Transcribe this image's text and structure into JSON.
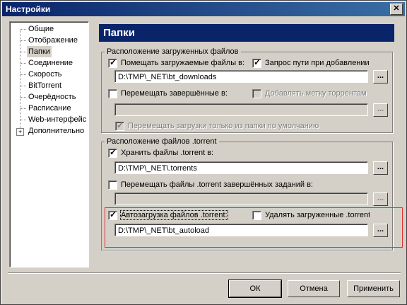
{
  "window": {
    "title": "Настройки"
  },
  "tree": {
    "items": [
      {
        "label": "Общие"
      },
      {
        "label": "Отображение"
      },
      {
        "label": "Папки"
      },
      {
        "label": "Соединение"
      },
      {
        "label": "Скорость"
      },
      {
        "label": "BitTorrent"
      },
      {
        "label": "Очерёдность"
      },
      {
        "label": "Расписание"
      },
      {
        "label": "Web-интерфейс"
      },
      {
        "label": "Дополнительно",
        "expander": "+"
      }
    ]
  },
  "panel": {
    "title": "Папки"
  },
  "downloads_group": {
    "legend": "Расположение загруженных файлов",
    "put_downloads_label": "Помещать загружаемые файлы в:",
    "ask_path_label": "Запрос пути при добавлении",
    "downloads_path": "D:\\TMP\\_NET\\bt_downloads",
    "move_completed_label": "Перемещать завершённые в:",
    "append_label_label": "Добавлять метку торрентам",
    "completed_path": "",
    "only_default_label": "Перемещать загрузки только из папки по умолчанию"
  },
  "torrent_group": {
    "legend": "Расположение файлов .torrent",
    "store_torrents_label": "Хранить файлы .torrent в:",
    "torrents_path": "D:\\TMP\\_NET\\.torrents",
    "move_completed_torrents_label": "Перемещать файлы .torrent завершённых заданий в:",
    "completed_torrents_path": "",
    "autoload_label": "Автозагрузка файлов .torrent:",
    "delete_loaded_label": "Удалять загруженные .torrent",
    "autoload_path": "D:\\TMP\\_NET\\bt_autoload"
  },
  "browse_label": "...",
  "buttons": {
    "ok": "ОК",
    "cancel": "Отмена",
    "apply": "Применить"
  }
}
